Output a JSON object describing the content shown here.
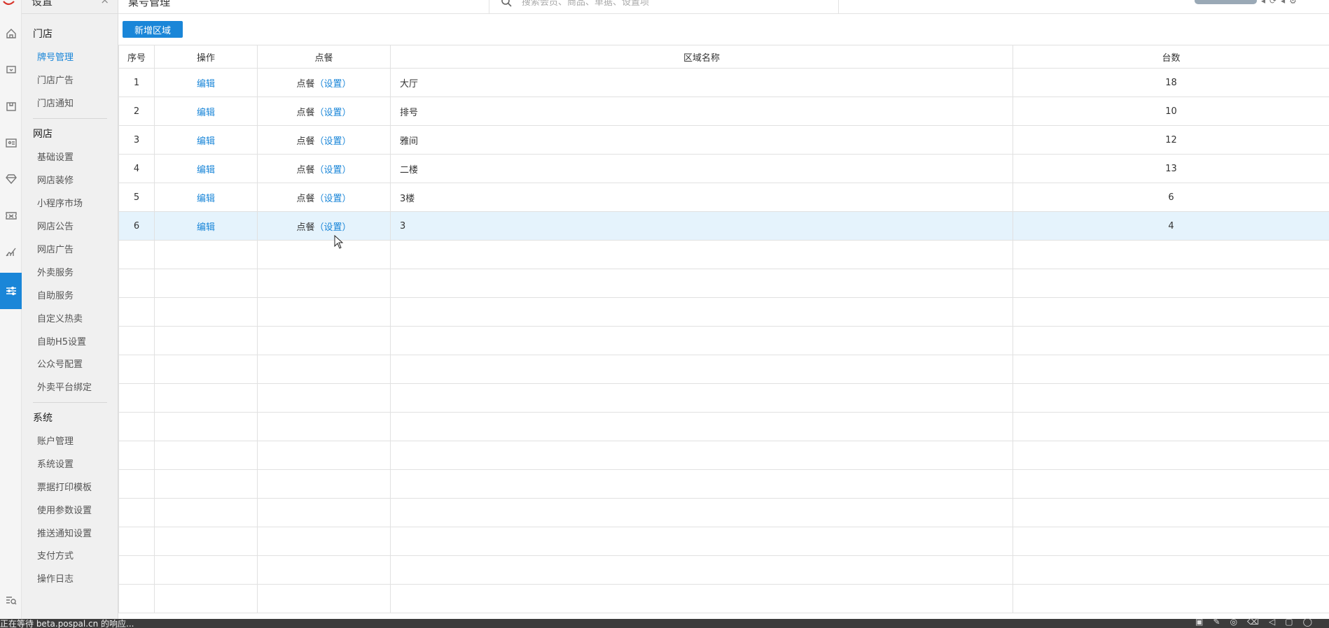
{
  "topbar": {
    "breadcrumb": "桌号管理",
    "search_placeholder": "搜索会员、商品、单据、设置项"
  },
  "menu": {
    "header_title": "设置",
    "close_glyph": "×",
    "groups": [
      {
        "title": "门店",
        "items": [
          {
            "label": "牌号管理"
          },
          {
            "label": "门店广告"
          },
          {
            "label": "门店通知"
          }
        ]
      },
      {
        "title": "网店",
        "items": [
          {
            "label": "基础设置"
          },
          {
            "label": "网店装修"
          },
          {
            "label": "小程序市场"
          },
          {
            "label": "网店公告"
          },
          {
            "label": "网店广告"
          },
          {
            "label": "外卖服务"
          },
          {
            "label": "自助服务"
          },
          {
            "label": "自定义热卖"
          },
          {
            "label": "自助H5设置"
          },
          {
            "label": "公众号配置"
          },
          {
            "label": "外卖平台绑定"
          }
        ]
      },
      {
        "title": "系统",
        "items": [
          {
            "label": "账户管理"
          },
          {
            "label": "系统设置"
          },
          {
            "label": "票据打印模板"
          },
          {
            "label": "使用参数设置"
          },
          {
            "label": "推送通知设置"
          },
          {
            "label": "支付方式"
          },
          {
            "label": "操作日志"
          }
        ]
      }
    ]
  },
  "toolbar": {
    "add_label": "新增区域"
  },
  "table": {
    "headers": {
      "index": "序号",
      "action": "操作",
      "order": "点餐",
      "name": "区域名称",
      "count": "台数"
    },
    "edit_label": "编辑",
    "order_label": "点餐",
    "order_setting_label": "（设置）",
    "rows": [
      {
        "index": "1",
        "name": "大厅",
        "count": "18"
      },
      {
        "index": "2",
        "name": "排号",
        "count": "10"
      },
      {
        "index": "3",
        "name": "雅间",
        "count": "12"
      },
      {
        "index": "4",
        "name": "二楼",
        "count": "13"
      },
      {
        "index": "5",
        "name": "3楼",
        "count": "6"
      },
      {
        "index": "6",
        "name": "3",
        "count": "4"
      }
    ],
    "selected_row": 6
  },
  "statusbar": {
    "message": "正在等待 beta.pospal.cn 的响应..."
  },
  "colors": {
    "accent": "#1a86d8",
    "selected_row": "#e5f3fc",
    "status_bar": "#3c3c3c"
  },
  "icons": {
    "rail": [
      "home-icon",
      "screen-icon",
      "box-icon",
      "member-card-icon",
      "diamond-icon",
      "ticket-icon",
      "chart-icon",
      "settings-sliders-icon",
      "search-list-icon"
    ]
  }
}
